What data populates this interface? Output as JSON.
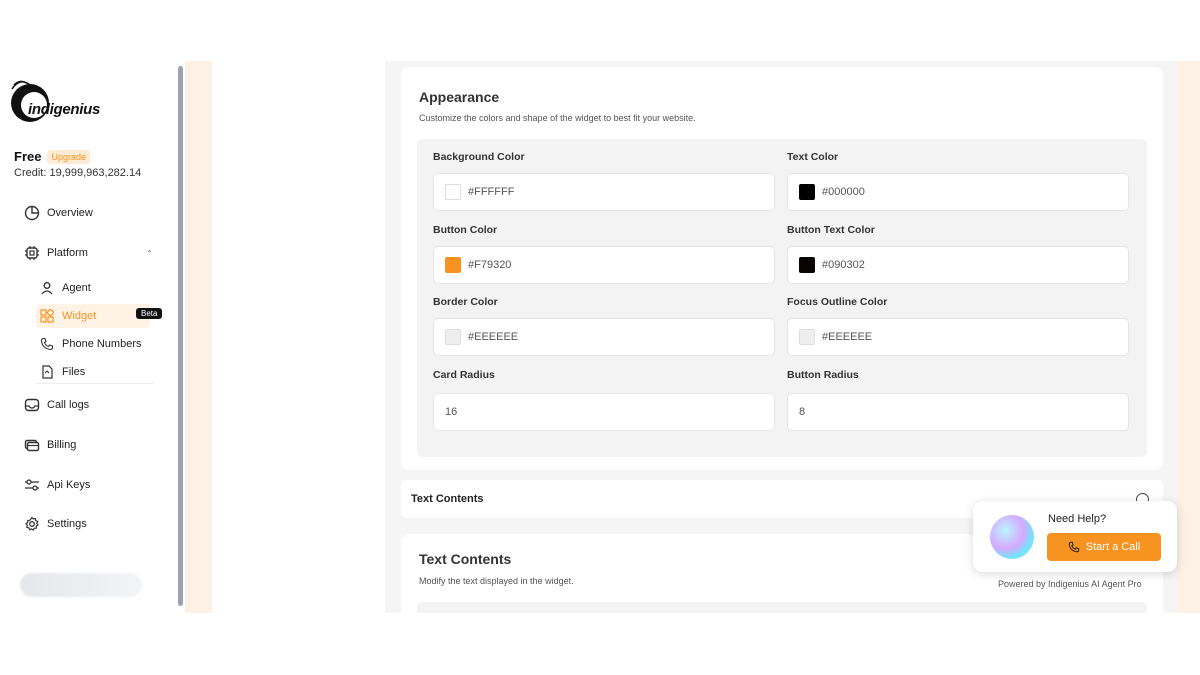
{
  "sidebar": {
    "logo_text": "indigenius",
    "plan_name": "Free",
    "upgrade_label": "Upgrade",
    "credit": "Credit: 19,999,963,282.14",
    "nav": {
      "overview": "Overview",
      "platform": "Platform",
      "call_logs": "Call logs",
      "billing": "Billing",
      "api_keys": "Api Keys",
      "settings": "Settings"
    },
    "sub": {
      "agent": "Agent",
      "widget": "Widget",
      "phone_numbers": "Phone Numbers",
      "files": "Files"
    },
    "beta_badge": "Beta"
  },
  "appearance": {
    "title": "Appearance",
    "subtitle": "Customize the colors and shape of the widget to best fit your website.",
    "fields": {
      "background_color": {
        "label": "Background Color",
        "value": "#FFFFFF",
        "swatch": "#FFFFFF"
      },
      "text_color": {
        "label": "Text Color",
        "value": "#000000",
        "swatch": "#000000"
      },
      "button_color": {
        "label": "Button Color",
        "value": "#F79320",
        "swatch": "#F79320"
      },
      "button_text_color": {
        "label": "Button Text Color",
        "value": "#090302",
        "swatch": "#090302"
      },
      "border_color": {
        "label": "Border Color",
        "value": "#EEEEEE",
        "swatch": "#EEEEEE"
      },
      "focus_outline_color": {
        "label": "Focus Outline Color",
        "value": "#EEEEEE",
        "swatch": "#EEEEEE"
      },
      "card_radius": {
        "label": "Card Radius",
        "value": "16"
      },
      "button_radius": {
        "label": "Button Radius",
        "value": "8"
      }
    }
  },
  "text_contents_bar": {
    "label": "Text Contents"
  },
  "text_contents": {
    "title": "Text Contents",
    "subtitle": "Modify the text displayed in the widget."
  },
  "help_widget": {
    "title": "Need Help?",
    "button_label": "Start a Call",
    "powered_by": "Powered by Indigenius AI Agent Pro"
  },
  "colors": {
    "accent": "#F79320",
    "peach_bg": "#FDF1E6"
  }
}
